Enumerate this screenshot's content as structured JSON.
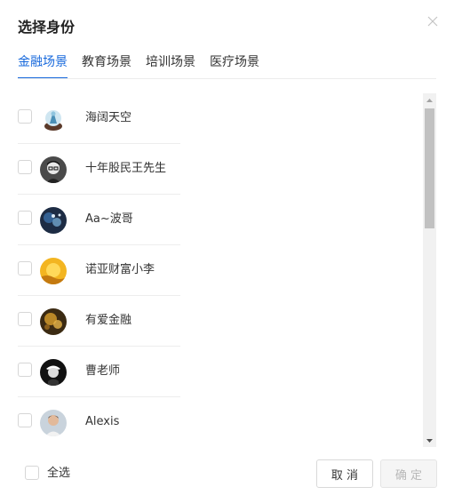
{
  "dialog": {
    "title": "选择身份"
  },
  "tabs": [
    {
      "label": "金融场景",
      "active": true
    },
    {
      "label": "教育场景",
      "active": false
    },
    {
      "label": "培训场景",
      "active": false
    },
    {
      "label": "医疗场景",
      "active": false
    }
  ],
  "identities": [
    {
      "name": "海阔天空",
      "checked": false,
      "avatar_icon": "snow-globe-avatar"
    },
    {
      "name": "十年股民王先生",
      "checked": false,
      "avatar_icon": "man-with-glasses-avatar"
    },
    {
      "name": "Aa~波哥",
      "checked": false,
      "avatar_icon": "dark-blue-abstract-avatar"
    },
    {
      "name": "诺亚财富小李",
      "checked": false,
      "avatar_icon": "sunset-avatar"
    },
    {
      "name": "有爱金融",
      "checked": false,
      "avatar_icon": "bokeh-lights-avatar"
    },
    {
      "name": "曹老师",
      "checked": false,
      "avatar_icon": "man-black-hat-avatar"
    },
    {
      "name": "Alexis",
      "checked": false,
      "avatar_icon": "person-photo-avatar"
    }
  ],
  "footer": {
    "select_all_label": "全选",
    "cancel_label": "取 消",
    "confirm_label": "确 定",
    "confirm_disabled": true
  },
  "colors": {
    "accent": "#1668dc",
    "divider": "#ececec",
    "disabled_text": "#b8b8b8"
  }
}
